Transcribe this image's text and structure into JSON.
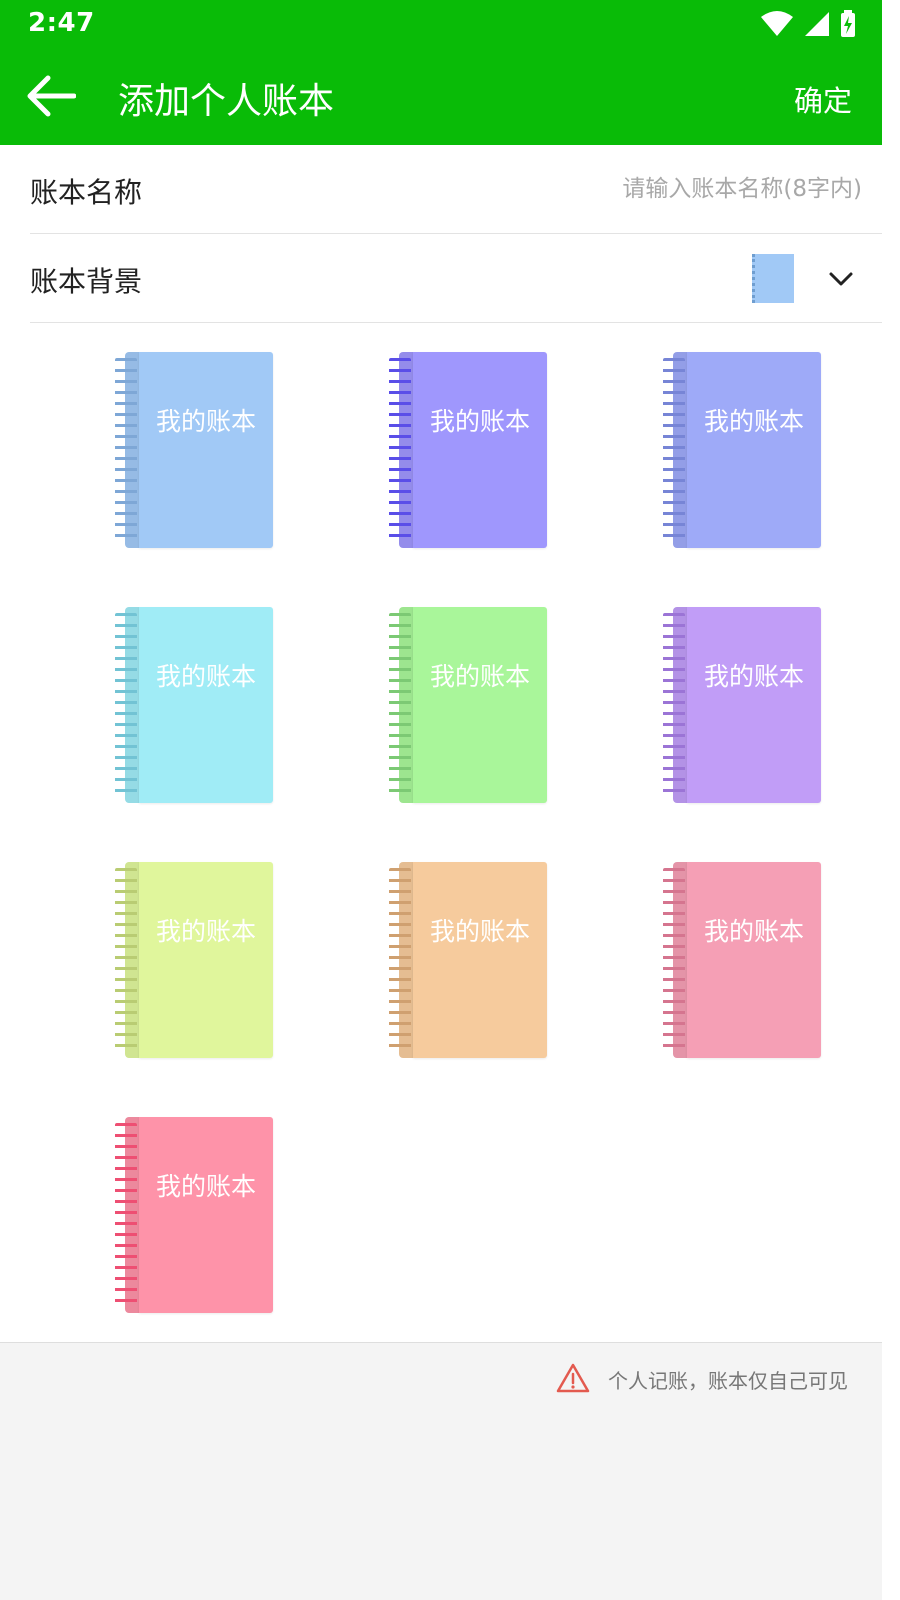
{
  "status_bar": {
    "time": "2:47"
  },
  "app_bar": {
    "title": "添加个人账本",
    "confirm_label": "确定",
    "background_color": "#09bb07"
  },
  "form": {
    "name_row": {
      "label": "账本名称",
      "placeholder": "请输入账本名称(8字内)",
      "value": ""
    },
    "background_row": {
      "label": "账本背景",
      "selected_color": "#a1c9f6"
    }
  },
  "notebooks": [
    {
      "label": "我的账本",
      "color": "#a1c9f6",
      "coil": "#7ea7d6"
    },
    {
      "label": "我的账本",
      "color": "#9f97fd",
      "coil": "#5a4ee8"
    },
    {
      "label": "我的账本",
      "color": "#9eaaf8",
      "coil": "#7785d6"
    },
    {
      "label": "我的账本",
      "color": "#a0ecf6",
      "coil": "#72c3d4"
    },
    {
      "label": "我的账本",
      "color": "#a9f69a",
      "coil": "#7cc974"
    },
    {
      "label": "我的账本",
      "color": "#c19df7",
      "coil": "#9b74d6"
    },
    {
      "label": "我的账本",
      "color": "#e0f69c",
      "coil": "#b9cc73"
    },
    {
      "label": "我的账本",
      "color": "#f6cb9d",
      "coil": "#cfa070"
    },
    {
      "label": "我的账本",
      "color": "#f59fb5",
      "coil": "#d5758f"
    },
    {
      "label": "我的账本",
      "color": "#fe93a9",
      "coil": "#ee4f73"
    }
  ],
  "notice": {
    "text": "个人记账，账本仅自己可见",
    "icon": "warning-triangle-icon",
    "icon_color": "#e35a4f"
  }
}
